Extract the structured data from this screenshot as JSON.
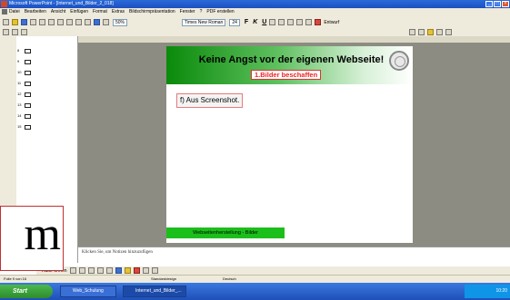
{
  "window": {
    "title": "Microsoft PowerPoint - [Internet_und_Bilder_2_018]"
  },
  "menu": {
    "items": [
      "Datei",
      "Bearbeiten",
      "Ansicht",
      "Einfügen",
      "Format",
      "Extras",
      "Bildschirmpräsentation",
      "Fenster",
      "?",
      "PDF erstellen"
    ]
  },
  "toolbar": {
    "zoom": "50%",
    "font": "Times New Roman",
    "font_size": "24",
    "design_label": "Entwurf"
  },
  "slide": {
    "title": "Keine Angst vor der eigenen Webseite!",
    "subtitle": "1.Bilder beschaffen",
    "body_text": "f) Aus Screenshot.",
    "footer": "Webseitenherstellung - Bilder"
  },
  "notes": {
    "placeholder": "Klicken Sie, um Notizen hinzuzufügen"
  },
  "outline": {
    "slides": [
      "8",
      "9",
      "10",
      "11",
      "12",
      "13",
      "14",
      "15"
    ]
  },
  "overlay": {
    "text": "m"
  },
  "drawing": {
    "autoshapes_label": "AutoFormen"
  },
  "status": {
    "slide_info": "Folie 9 von 16",
    "design": "Standarddesign",
    "language": "Deutsch"
  },
  "taskbar": {
    "start_label": "Start",
    "tasks": [
      "Web_Schulung",
      "Internet_und_Bilder_..."
    ],
    "clock": "10:20"
  }
}
